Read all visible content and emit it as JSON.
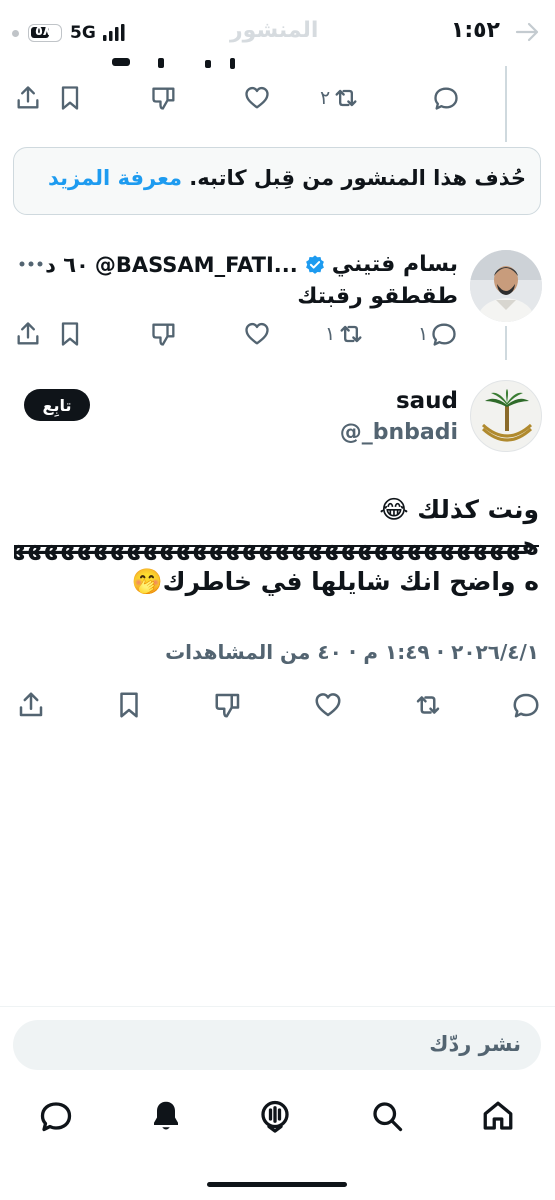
{
  "status_bar": {
    "time": "١:٥٢",
    "network": "5G",
    "battery": "٥٨"
  },
  "header": {
    "title": "المنشور"
  },
  "top_post": {
    "replies": "",
    "reposts": "٢",
    "likes": "",
    "views": ""
  },
  "deleted_notice": {
    "text": "حُذف هذا المنشور من قِبل كاتبه.",
    "learn_more": "معرفة المزيد"
  },
  "reply_post": {
    "display_name": "بسام فتيني",
    "handle": "@BASSAM_FATI...",
    "time": "٦٠ د",
    "text": "طقطقو رقبتك",
    "replies": "١",
    "reposts": "١"
  },
  "main_post": {
    "display_name": "saud",
    "handle": "@_bnbadi",
    "follow_label": "تابِع",
    "line1": "ونت كذلك 😂",
    "line2": "هههههههههههههههههههههههههههههههههههههه",
    "line3": "ه واضح انك شايلها في خاطرك🤭",
    "meta": "٢٠٢٦/٤/١ · ١:٤٩ م · ٤٠ من المشاهدات"
  },
  "reply_input": {
    "placeholder": "نشر ردّك"
  },
  "bottom_nav": {
    "items": [
      "home-icon",
      "search-icon",
      "spaces-icon",
      "notifications-icon",
      "messages-icon"
    ]
  },
  "colors": {
    "accent": "#1d9bf0",
    "muted": "#536471",
    "border": "#cfd9de"
  }
}
